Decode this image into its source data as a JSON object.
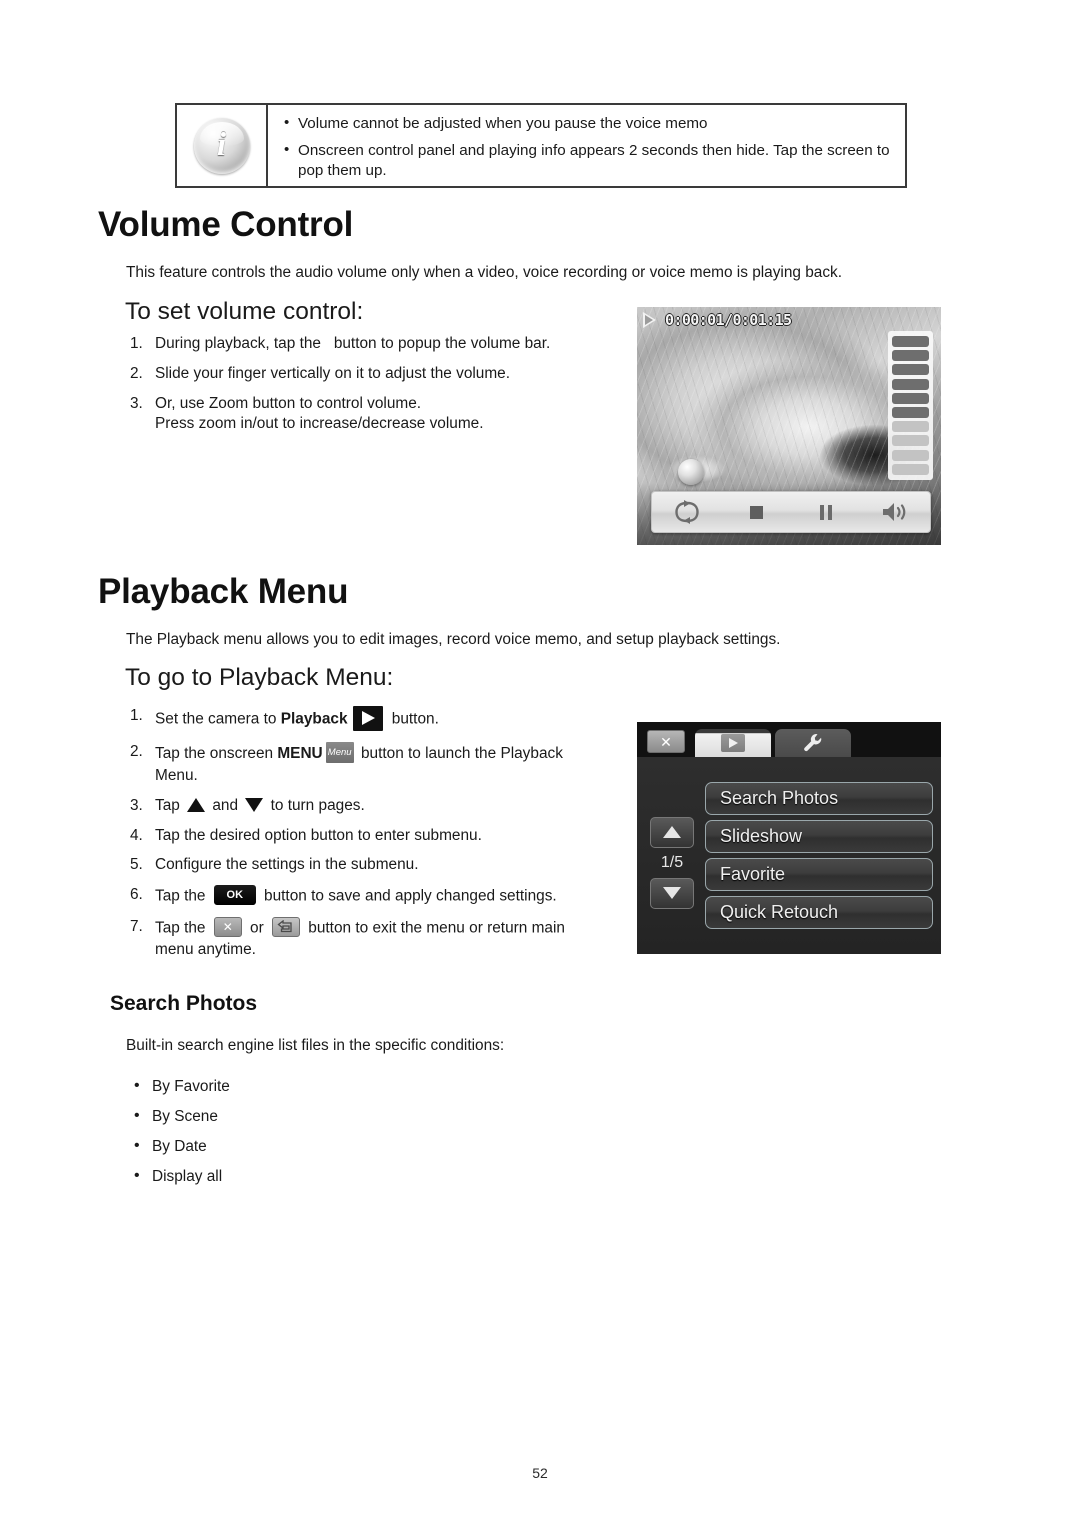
{
  "note": {
    "icon": "info-icon",
    "bullet_char": "•",
    "lines": [
      "Volume cannot be adjusted when you pause the voice memo",
      "Onscreen control panel and playing info appears 2 seconds then hide. Tap the screen to pop them up."
    ]
  },
  "volume_control": {
    "heading": "Volume Control",
    "intro": "This feature controls the audio volume only when a video, voice recording or voice memo is playing back.",
    "subheading": "To set volume control:",
    "steps": [
      {
        "num": "1.",
        "text_before": "During playback, tap the",
        "icon": "",
        "text_after": "button to popup the volume bar."
      },
      {
        "num": "2.",
        "text_before": "Slide your finger vertically on it to adjust the volume.",
        "icon": "",
        "text_after": ""
      },
      {
        "num": "3.",
        "text_before": "Or, use Zoom button to control volume.",
        "icon": "",
        "text_after": "",
        "sub": "Press zoom in/out to increase/decrease volume."
      }
    ]
  },
  "lcd_video": {
    "name": "video-playback-screen",
    "play_state_icon": "play-icon",
    "timecode": "0:00:01/0:01:15",
    "volume_segments_total": 10,
    "volume_segments_filled": 6,
    "controls": [
      {
        "name": "repeat-button",
        "label": "repeat-icon"
      },
      {
        "name": "stop-button",
        "label": "stop-icon"
      },
      {
        "name": "pause-button",
        "label": "pause-icon"
      },
      {
        "name": "volume-button",
        "label": "speaker-icon"
      }
    ]
  },
  "playback_menu": {
    "heading": "Playback Menu",
    "intro": "The Playback menu allows you to edit images, record voice memo, and setup playback settings.",
    "subheading": "To go to Playback Menu:",
    "steps": [
      {
        "num": "1.",
        "a": "Set the camera to ",
        "b_bold": "Playback",
        "icon": "play-button-icon",
        "c": " button."
      },
      {
        "num": "2.",
        "a": "Tap the onscreen ",
        "b_bold": "MENU",
        "icon": "menu-button-icon",
        "c": " button to launch the Playback Menu."
      },
      {
        "num": "3.",
        "a": "Tap ",
        "icon": "up-arrow-icon",
        "mid": " and ",
        "icon2": "down-arrow-icon",
        "c": " to turn pages."
      },
      {
        "num": "4.",
        "a": "Tap the desired option button to enter submenu."
      },
      {
        "num": "5.",
        "a": "Configure the settings in the submenu."
      },
      {
        "num": "6.",
        "a": "Tap the ",
        "icon": "ok-button-icon",
        "c": " button to save and apply changed settings."
      },
      {
        "num": "7.",
        "a": "Tap the ",
        "icon": "close-button-icon",
        "mid": " or ",
        "icon2": "return-button-icon",
        "c": " button to exit the menu or return main menu anytime."
      }
    ]
  },
  "lcd_menu": {
    "name": "playback-menu-screen",
    "close_label": "✕",
    "tabs": [
      {
        "name": "tab-playback",
        "icon": "play-icon",
        "active": true
      },
      {
        "name": "tab-setup",
        "icon": "wrench-icon",
        "active": false
      }
    ],
    "page_indicator": "1/5",
    "nav_up": "up-arrow-icon",
    "nav_down": "down-arrow-icon",
    "items": [
      "Search Photos",
      "Slideshow",
      "Favorite",
      "Quick Retouch"
    ]
  },
  "search_photos": {
    "heading": "Search Photos",
    "intro": "Built-in search engine list files in the specific conditions:",
    "bullet_char": "•",
    "options": [
      "By Favorite",
      "By Scene",
      "By Date",
      "Display all"
    ]
  },
  "footer": {
    "page_number": "52"
  }
}
